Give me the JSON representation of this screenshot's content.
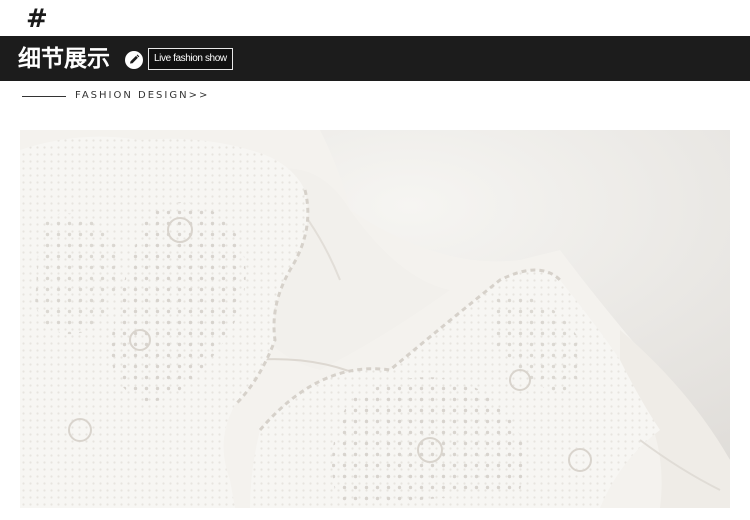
{
  "header": {
    "hash_symbol": "#",
    "section_title": "细节展示",
    "tag_label": "Live fashion show"
  },
  "subheader": {
    "label": "FASHION DESIGN>>"
  },
  "photo": {
    "subject": "white-embroidered-blouse-collar-detail"
  },
  "colors": {
    "banner": "#1c1c1c",
    "fabric": "#f4f2ee",
    "background_wall": "#e7e5e2"
  }
}
